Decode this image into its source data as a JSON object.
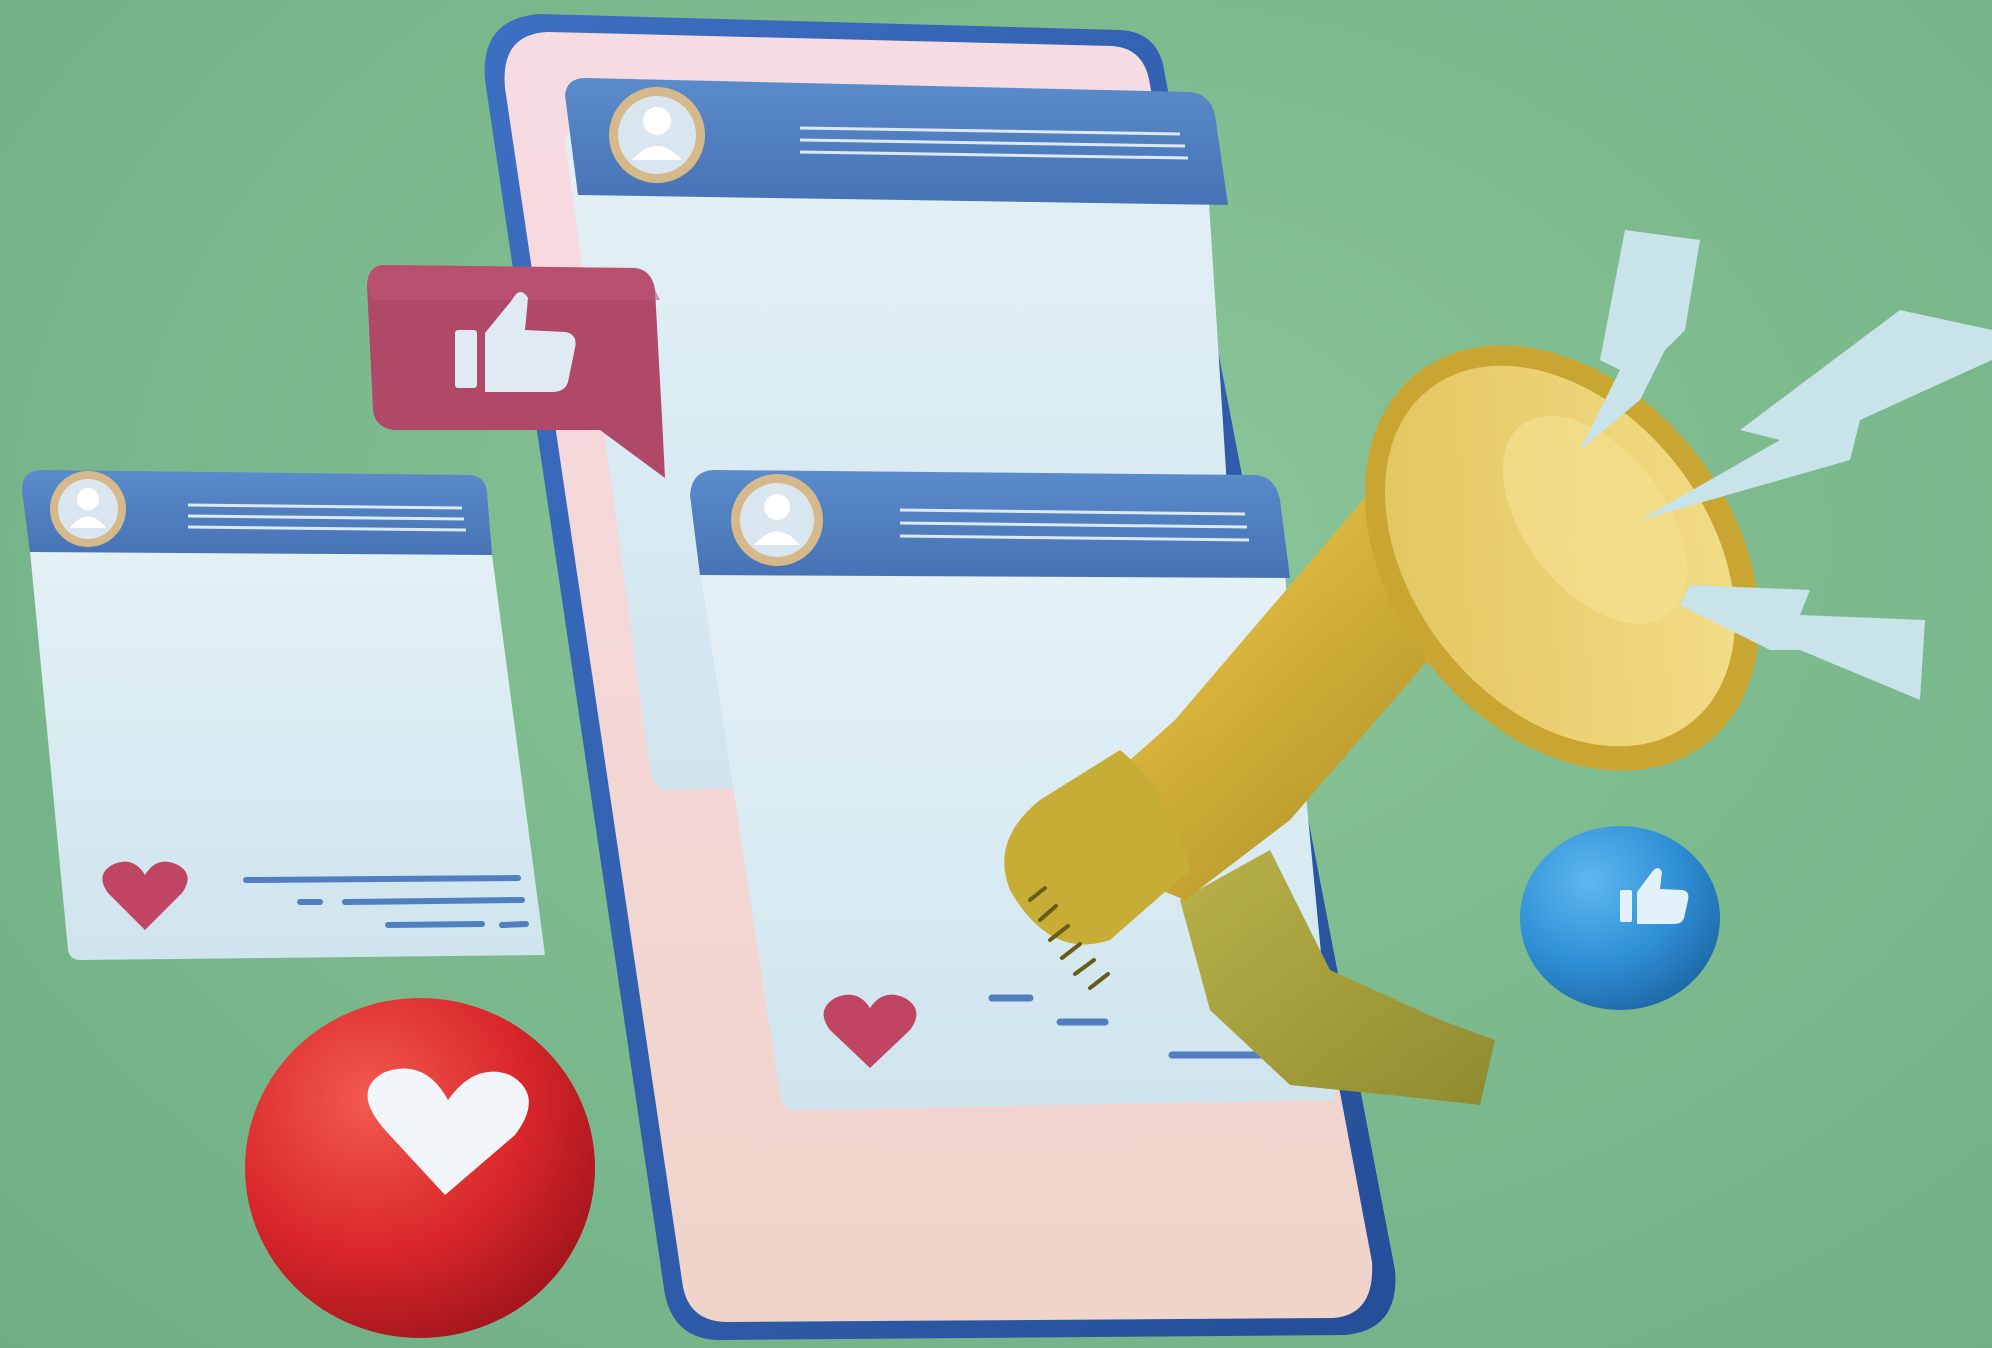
{
  "scene": {
    "description_free": true,
    "colors": {
      "background": "#7dbb8f",
      "phone_frame": "#2f5fb0",
      "phone_screen": "#f3d9d2",
      "card_body": "#d9ebf2",
      "card_header": "#4f7fc0",
      "avatar_ring": "#d6b98a",
      "like_bubble": "#b44c6a",
      "heart_pink": "#c04563",
      "heart_ball": "#d8262a",
      "like_ball": "#2f8fd6",
      "megaphone_gold": "#d6b23a",
      "lightning": "#c9e3ea"
    },
    "icons": [
      "smartphone-icon",
      "post-card-icon",
      "avatar-icon",
      "thumbs-up-icon",
      "heart-icon",
      "megaphone-icon",
      "lightning-icon"
    ]
  }
}
